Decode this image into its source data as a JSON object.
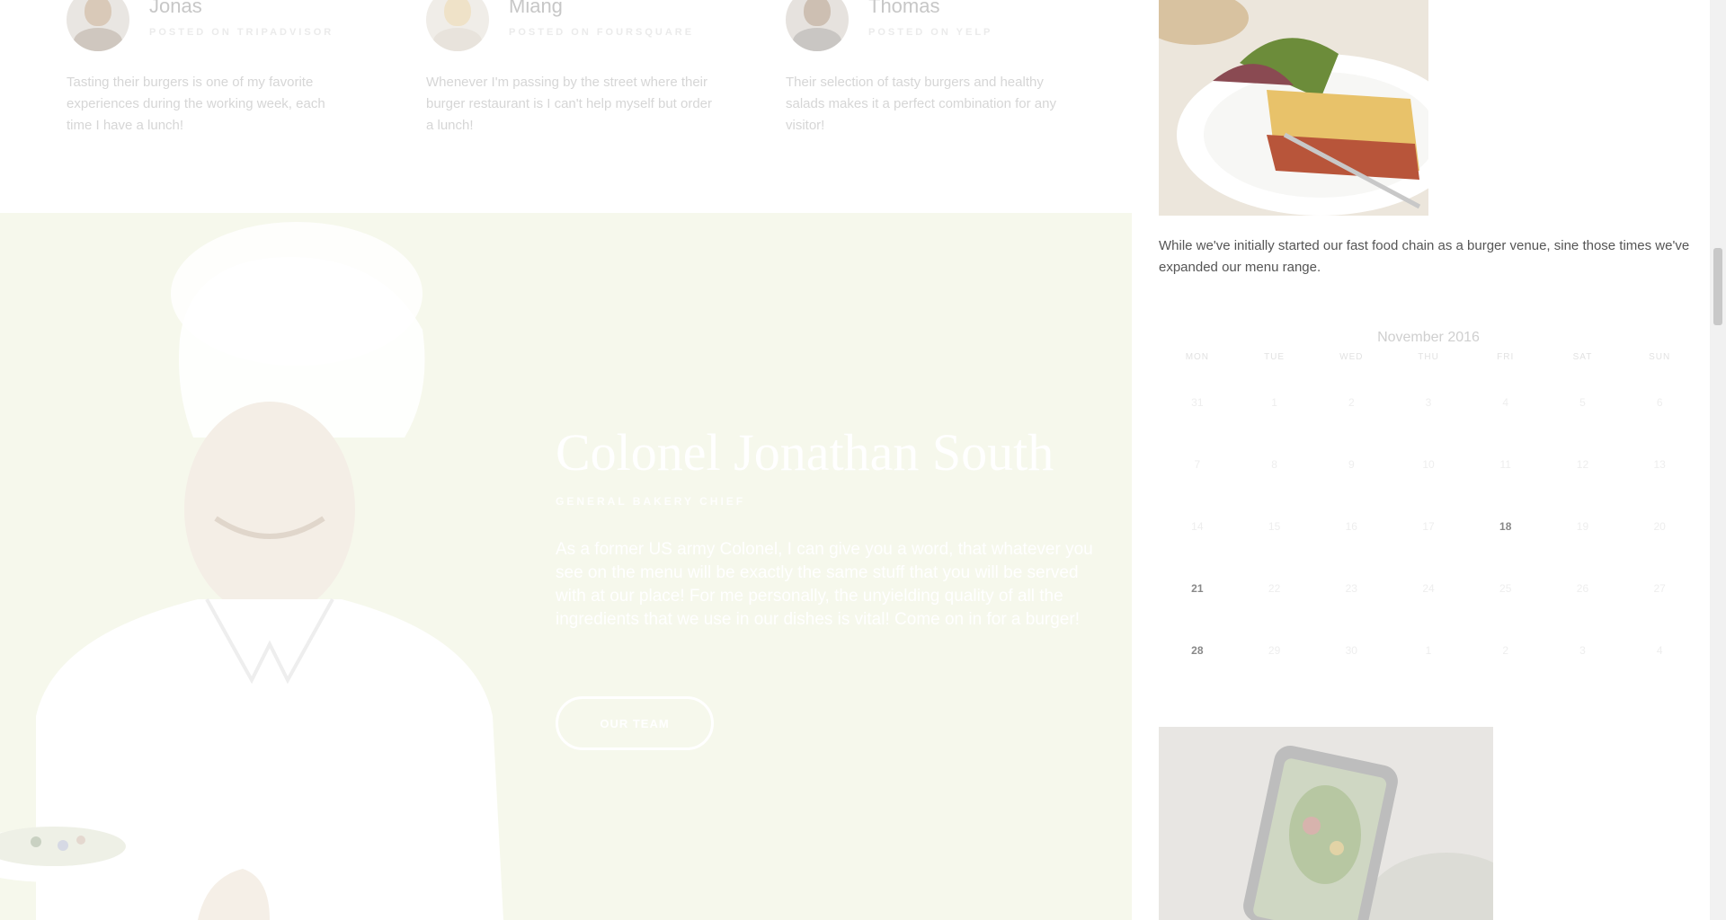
{
  "testimonials": [
    {
      "name": "Jonas",
      "source": "POSTED ON TRIPADVISOR",
      "text": "Tasting their burgers is one of my favorite experiences during the working week, each time I have a lunch!"
    },
    {
      "name": "Miang",
      "source": "POSTED ON FOURSQUARE",
      "text": "Whenever I'm passing by the street where their burger restaurant is I can't help myself but order a lunch!"
    },
    {
      "name": "Thomas",
      "source": "POSTED ON YELP",
      "text": "Their selection of tasty burgers and healthy salads makes it a perfect combination for any visitor!"
    }
  ],
  "hero": {
    "title": "Colonel Jonathan South",
    "subtitle": "GENERAL BAKERY CHIEF",
    "text": "As a former US army Colonel, I can give you a word, that whatever you see on the menu will be exactly the same stuff that you will be served with at our place! For me personally, the unyielding quality of all the ingredients that we use in our dishes is vital! Come on in for a burger!",
    "button": "OUR TEAM"
  },
  "sidebar": {
    "about_text": "While we've initially started our fast food chain as a burger venue, sine those times we've expanded our menu range.",
    "calendar": {
      "caption": "November 2016",
      "days": [
        "MON",
        "TUE",
        "WED",
        "THU",
        "FRI",
        "SAT",
        "SUN"
      ],
      "weeks": [
        [
          "31",
          "1",
          "2",
          "3",
          "4",
          "5",
          "6"
        ],
        [
          "7",
          "8",
          "9",
          "10",
          "11",
          "12",
          "13"
        ],
        [
          "14",
          "15",
          "16",
          "17",
          "18",
          "19",
          "20"
        ],
        [
          "21",
          "22",
          "23",
          "24",
          "25",
          "26",
          "27"
        ],
        [
          "28",
          "29",
          "30",
          "1",
          "2",
          "3",
          "4"
        ]
      ],
      "highlighted": [
        "18",
        "21",
        "28"
      ]
    }
  }
}
